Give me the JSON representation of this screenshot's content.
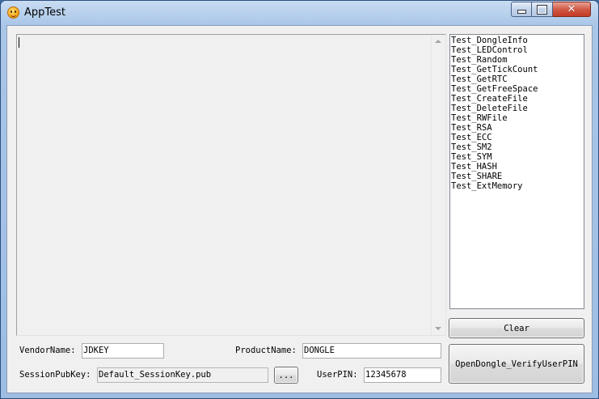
{
  "window": {
    "title": "AppTest",
    "minimize_icon": "minimize-icon",
    "maximize_icon": "maximize-icon",
    "close_glyph": "✕"
  },
  "tests": [
    "Test_DongleInfo",
    "Test_LEDControl",
    "Test_Random",
    "Test_GetTickCount",
    "Test_GetRTC",
    "Test_GetFreeSpace",
    "Test_CreateFile",
    "Test_DeleteFile",
    "Test_RWFile",
    "Test_RSA",
    "Test_ECC",
    "Test_SM2",
    "Test_SYM",
    "Test_HASH",
    "Test_SHARE",
    "Test_ExtMemory"
  ],
  "buttons": {
    "clear": "Clear",
    "open": "OpenDongle_VerifyUserPIN",
    "browse": "..."
  },
  "form": {
    "vendor_label": "VendorName:",
    "vendor_value": "JDKEY",
    "product_label": "ProductName:",
    "product_value": "DONGLE",
    "session_label": "SessionPubKey:",
    "session_value": "Default_SessionKey.pub",
    "pin_label": "UserPIN:",
    "pin_value": "12345678"
  }
}
